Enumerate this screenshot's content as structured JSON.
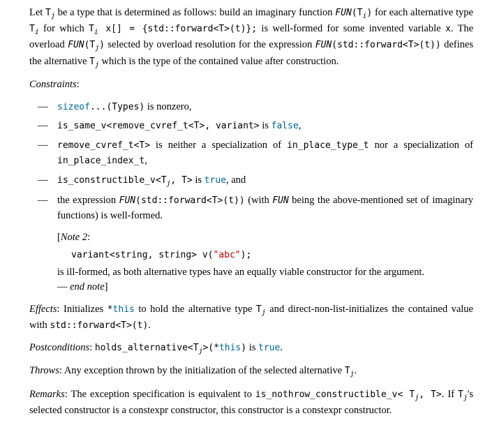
{
  "intro": {
    "p1a": "Let ",
    "p1b": " be a type that is determined as follows: build an imaginary function ",
    "p1c": " for each alternative type ",
    "p1d": " for which ",
    "p1e": " is well-formed for some invented variable ",
    "p1f": ". The overload ",
    "p1g": " selected by overload resolution for the expression ",
    "p1h": " defines the alternative ",
    "p1i": " which is the type of the contained value after construction.",
    "tj": "T",
    "ti": "T",
    "funTi": "FUN",
    "funTiArg": "(T",
    "funTiClose": ")",
    "decl1": "T",
    "decl2": " x[] = {std::forward<T>(t)};",
    "varX": "x",
    "funTj": "FUN",
    "funTjArg": "(T",
    "funTjClose": ")",
    "funFwd": "FUN",
    "funFwdArg": "(std::forward<T>(t))"
  },
  "constraints": {
    "label": "Constraints",
    "colon": ":",
    "c1a": "sizeof",
    "c1b": "...(Types)",
    "c1c": " is nonzero,",
    "c2a": "is_same_v<remove_cvref_t<T>, variant>",
    "c2b": " is ",
    "c2c": "false",
    "c2d": ",",
    "c3a": "remove_cvref_t<T>",
    "c3b": " is neither a specialization of ",
    "c3c": "in_place_type_t",
    "c3d": " nor a specialization of ",
    "c3e": "in_place_index_t",
    "c3f": ",",
    "c4a": "is_constructible_v<T",
    "c4b": ", T>",
    "c4c": " is ",
    "c4d": "true",
    "c4e": ", and",
    "c5a": "the expression ",
    "c5b": "FUN",
    "c5c": "(std::forward<T>(t))",
    "c5d": " (with ",
    "c5e": "FUN",
    "c5f": " being the above-mentioned set of imaginary functions) is well-formed."
  },
  "note": {
    "open": "[",
    "label": "Note 2",
    "colon": ":",
    "code1": "variant<string, string> v(",
    "codeStr": "\"abc\"",
    "code2": ");",
    "text": "is ill-formed, as both alternative types have an equally viable constructor for the argument.",
    "enddash": "— ",
    "end": "end note",
    "close": "]"
  },
  "effects": {
    "label": "Effects",
    "colon": ": Initializes ",
    "this": "*",
    "thisKw": "this",
    "mid1": " to hold the alternative type ",
    "tj": "T",
    "mid2": " and direct-non-list-initializes the contained value with ",
    "fwd": "std::forward<T>(t)",
    "dot": "."
  },
  "post": {
    "label": "Postconditions",
    "colon": ": ",
    "ha1": "holds_alternative<T",
    "ha2": ">(*",
    "thisKw": "this",
    "ha3": ")",
    "is": " is ",
    "true": "true",
    "dot": "."
  },
  "throws": {
    "label": "Throws",
    "colon": ": Any exception thrown by the initialization of the selected alternative ",
    "tj": "T",
    "dot": "."
  },
  "remarks": {
    "label": "Remarks",
    "colon": ": The exception specification is equivalent to ",
    "nothrow1": "is_nothrow_constructible_v< T",
    "nothrow2": ", T>",
    "mid": ". If ",
    "tj": "T",
    "tail": "'s selected constructor is a constexpr constructor, this constructor is a constexpr constructor."
  },
  "sub": {
    "i": "i",
    "j": "j"
  }
}
